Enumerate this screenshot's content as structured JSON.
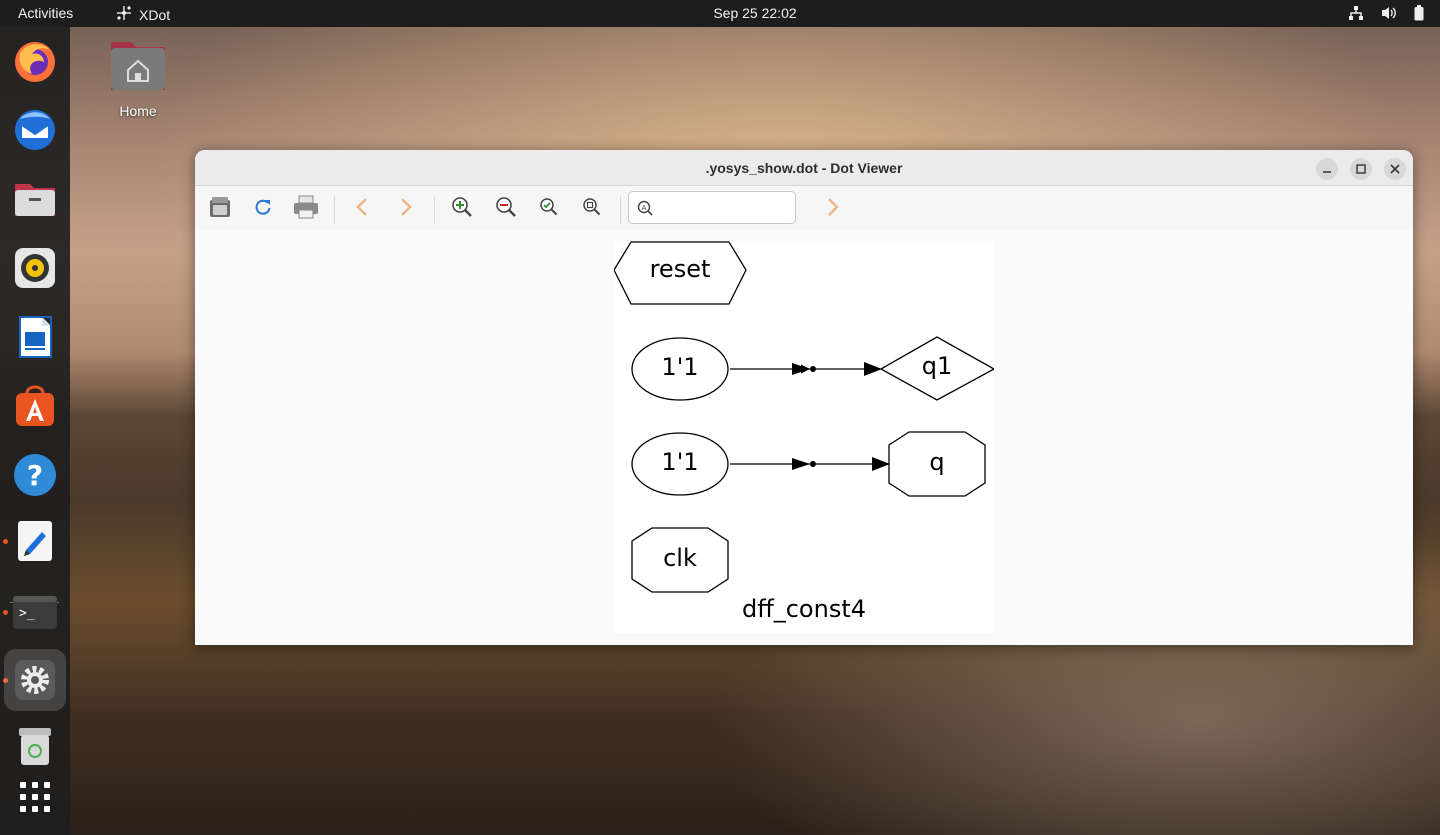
{
  "topbar": {
    "activities": "Activities",
    "app_name": "XDot",
    "clock": "Sep 25  22:02"
  },
  "desktop": {
    "home_label": "Home"
  },
  "dock": {
    "items": [
      "firefox-icon",
      "thunderbird-icon",
      "files-icon",
      "rhythmbox-icon",
      "writer-icon",
      "app-center-icon",
      "help-icon",
      "text-editor-icon",
      "terminal-icon",
      "settings-icon",
      "trash-icon",
      "app-grid-icon"
    ],
    "accent": "#e95420"
  },
  "window": {
    "title": ".yosys_show.dot - Dot Viewer",
    "search": {
      "value": "",
      "placeholder": ""
    }
  },
  "graph": {
    "nodes": {
      "reset": "reset",
      "const_a": "1'1",
      "q1": "q1",
      "const_b": "1'1",
      "q": "q",
      "clk": "clk"
    },
    "edges": [
      [
        "1'1",
        "q1"
      ],
      [
        "1'1",
        "q"
      ]
    ],
    "label": "dff_const4"
  }
}
